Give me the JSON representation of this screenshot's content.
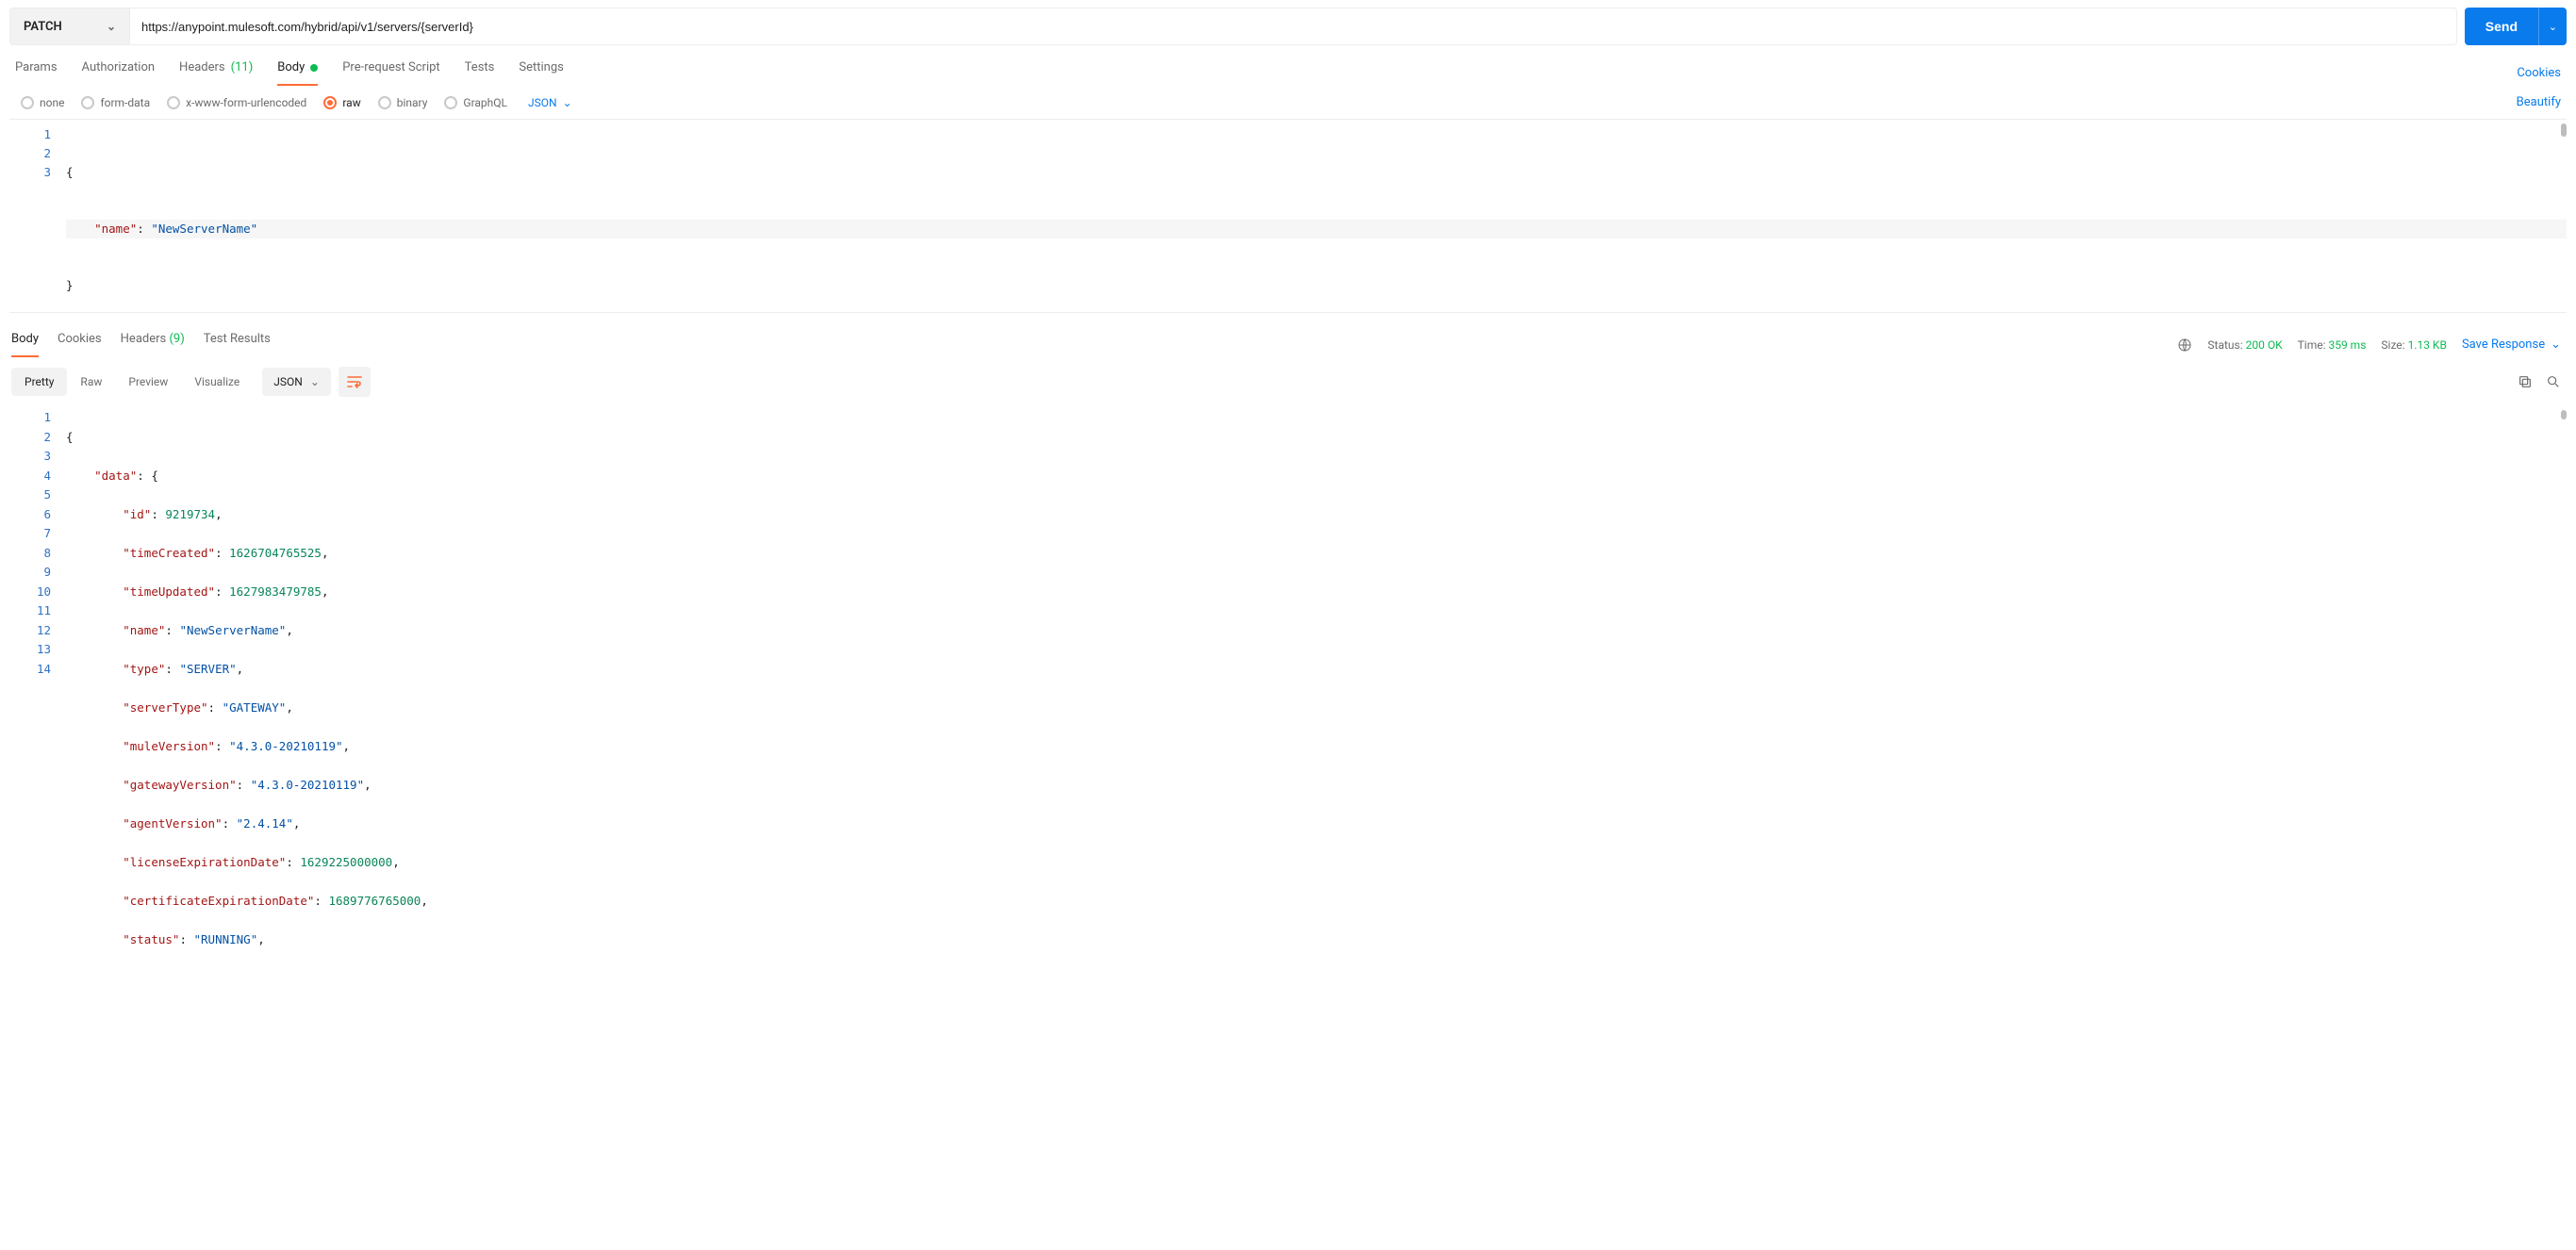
{
  "request": {
    "method": "PATCH",
    "url": "https://anypoint.mulesoft.com/hybrid/api/v1/servers/{serverId}",
    "send_label": "Send"
  },
  "tabs": {
    "params": "Params",
    "authorization": "Authorization",
    "headers": "Headers",
    "headers_count": "(11)",
    "body": "Body",
    "prerequest": "Pre-request Script",
    "tests": "Tests",
    "settings": "Settings",
    "cookies": "Cookies"
  },
  "body_types": {
    "none": "none",
    "form_data": "form-data",
    "x_www": "x-www-form-urlencoded",
    "raw": "raw",
    "binary": "binary",
    "graphql": "GraphQL",
    "lang": "JSON",
    "beautify": "Beautify"
  },
  "request_body": {
    "line1": "{",
    "line2_key": "\"name\"",
    "line2_sep": ": ",
    "line2_val": "\"NewServerName\"",
    "line3": "}"
  },
  "response_tabs": {
    "body": "Body",
    "cookies": "Cookies",
    "headers": "Headers",
    "headers_count": "(9)",
    "test_results": "Test Results"
  },
  "response_meta": {
    "status_label": "Status:",
    "status_value": "200 OK",
    "time_label": "Time:",
    "time_value": "359 ms",
    "size_label": "Size:",
    "size_value": "1.13 KB",
    "save_response": "Save Response"
  },
  "response_views": {
    "pretty": "Pretty",
    "raw": "Raw",
    "preview": "Preview",
    "visualize": "Visualize",
    "lang": "JSON"
  },
  "response_body": {
    "l1": "{",
    "l2_k": "\"data\"",
    "l2_s": ": {",
    "l3_k": "\"id\"",
    "l3_v": "9219734",
    "l3_t": ",",
    "l4_k": "\"timeCreated\"",
    "l4_v": "1626704765525",
    "l4_t": ",",
    "l5_k": "\"timeUpdated\"",
    "l5_v": "1627983479785",
    "l5_t": ",",
    "l6_k": "\"name\"",
    "l6_v": "\"NewServerName\"",
    "l6_t": ",",
    "l7_k": "\"type\"",
    "l7_v": "\"SERVER\"",
    "l7_t": ",",
    "l8_k": "\"serverType\"",
    "l8_v": "\"GATEWAY\"",
    "l8_t": ",",
    "l9_k": "\"muleVersion\"",
    "l9_v": "\"4.3.0-20210119\"",
    "l9_t": ",",
    "l10_k": "\"gatewayVersion\"",
    "l10_v": "\"4.3.0-20210119\"",
    "l10_t": ",",
    "l11_k": "\"agentVersion\"",
    "l11_v": "\"2.4.14\"",
    "l11_t": ",",
    "l12_k": "\"licenseExpirationDate\"",
    "l12_v": "1629225000000",
    "l12_t": ",",
    "l13_k": "\"certificateExpirationDate\"",
    "l13_v": "1689776765000",
    "l13_t": ",",
    "l14_k": "\"status\"",
    "l14_v": "\"RUNNING\"",
    "l14_t": ","
  }
}
